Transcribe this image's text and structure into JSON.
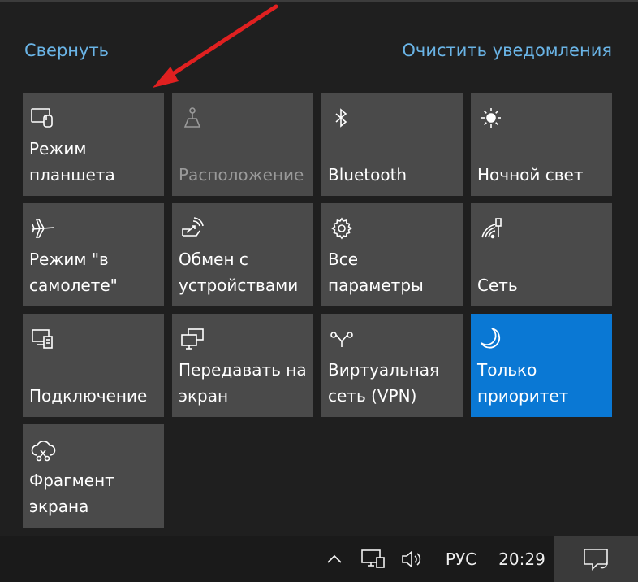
{
  "header": {
    "collapse_label": "Свернуть",
    "clear_label": "Очистить уведомления"
  },
  "tiles": [
    {
      "label": "Режим\nпланшета",
      "icon": "tablet-mode-icon",
      "state": "normal"
    },
    {
      "label": "Расположение",
      "icon": "location-icon",
      "state": "disabled"
    },
    {
      "label": "Bluetooth",
      "icon": "bluetooth-icon",
      "state": "normal"
    },
    {
      "label": "Ночной свет",
      "icon": "night-light-icon",
      "state": "normal"
    },
    {
      "label": "Режим \"в\nсамолете\"",
      "icon": "airplane-icon",
      "state": "normal"
    },
    {
      "label": "Обмен с\nустройствами",
      "icon": "nearby-sharing-icon",
      "state": "normal"
    },
    {
      "label": "Все\nпараметры",
      "icon": "settings-gear-icon",
      "state": "normal"
    },
    {
      "label": "Сеть",
      "icon": "network-icon",
      "state": "normal"
    },
    {
      "label": "Подключение",
      "icon": "connect-icon",
      "state": "normal"
    },
    {
      "label": "Передавать на\nэкран",
      "icon": "project-icon",
      "state": "normal"
    },
    {
      "label": "Виртуальная\nсеть (VPN)",
      "icon": "vpn-icon",
      "state": "normal"
    },
    {
      "label": "Только\nприоритет",
      "icon": "focus-assist-moon-icon",
      "state": "active"
    },
    {
      "label": "Фрагмент\nэкрана",
      "icon": "screen-snip-icon",
      "state": "normal"
    }
  ],
  "taskbar": {
    "language": "РУС",
    "time": "20:29",
    "icons": [
      "chevron-up-icon",
      "network-monitor-icon",
      "volume-icon",
      "notification-icon"
    ]
  },
  "colors": {
    "background": "#1f1f1f",
    "tile": "#4a4a4a",
    "tile_active": "#0a78d4",
    "link": "#6ab4e6",
    "annotation_arrow": "#e02020"
  }
}
